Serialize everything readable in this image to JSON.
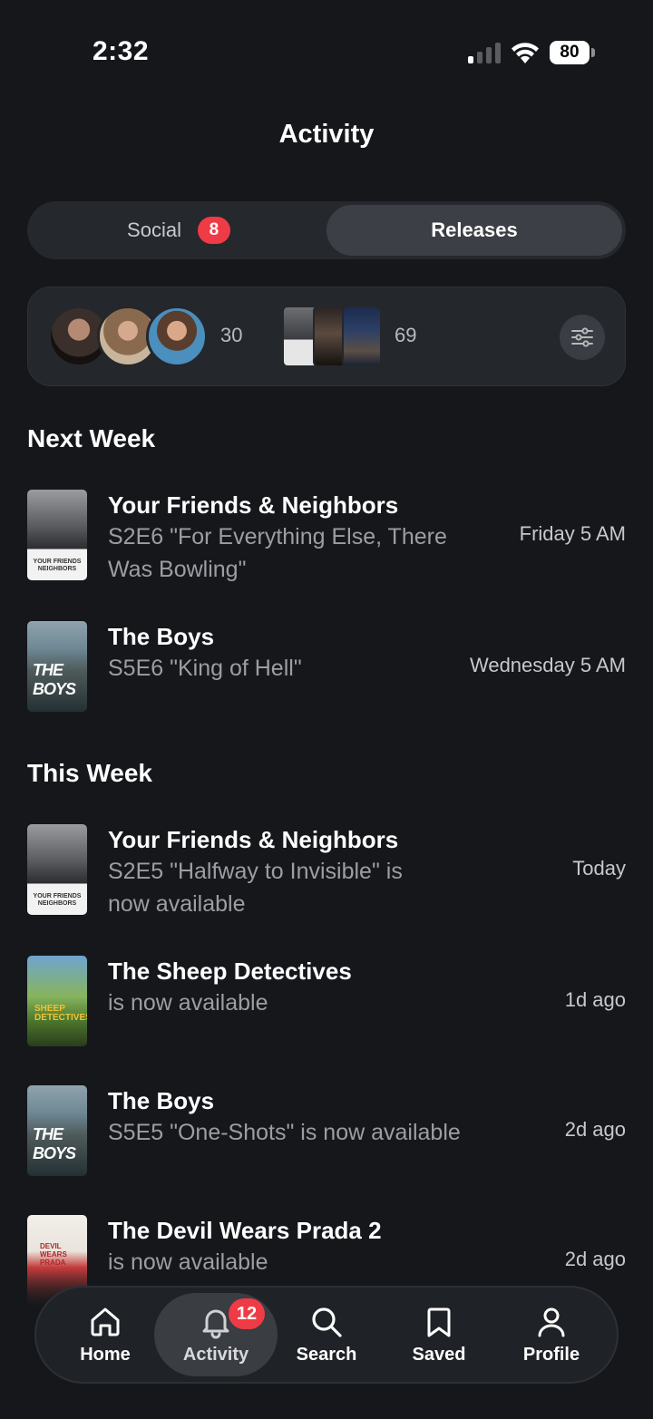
{
  "status_bar": {
    "time": "2:32",
    "battery": "80"
  },
  "header": {
    "title": "Activity"
  },
  "segmented": {
    "social_label": "Social",
    "social_badge": "8",
    "releases_label": "Releases",
    "selected": "Releases"
  },
  "follow_summary": {
    "people_count": "30",
    "titles_count": "69",
    "filter_icon": "sliders-icon"
  },
  "sections": [
    {
      "title": "Next Week",
      "items": [
        {
          "title": "Your Friends & Neighbors",
          "subtitle_line1": "S2E6 \"For Everything Else, There",
          "subtitle_line2": "Was Bowling\"",
          "time": "Friday 5 AM",
          "poster_text": "YOUR FRIENDS NEIGHBORS"
        },
        {
          "title": "The Boys",
          "subtitle_line1": "S5E6 \"King of Hell\"",
          "subtitle_line2": "",
          "time": "Wednesday 5 AM",
          "poster_text": "THE BOYS"
        }
      ]
    },
    {
      "title": "This Week",
      "items": [
        {
          "title": "Your Friends & Neighbors",
          "subtitle_line1": "S2E5 \"Halfway to Invisible\" is",
          "subtitle_line2": "now available",
          "time": "Today",
          "poster_text": "YOUR FRIENDS NEIGHBORS"
        },
        {
          "title": "The Sheep Detectives",
          "subtitle_line1": "is now available",
          "subtitle_line2": "",
          "time": "1d ago",
          "poster_text": "SHEEP DETECTIVES"
        },
        {
          "title": "The Boys",
          "subtitle_line1": "S5E5 \"One-Shots\" is now available",
          "subtitle_line2": "",
          "time": "2d ago",
          "poster_text": "THE BOYS"
        },
        {
          "title": "The Devil Wears Prada 2",
          "subtitle_line1": "is now available",
          "subtitle_line2": "",
          "time": "2d ago",
          "poster_text": "DEVIL WEARS PRADA"
        }
      ]
    }
  ],
  "nav": {
    "home": "Home",
    "activity": "Activity",
    "activity_badge": "12",
    "search": "Search",
    "saved": "Saved",
    "profile": "Profile",
    "selected": "Activity"
  },
  "colors": {
    "background": "#15171b",
    "accent_badge": "#ef3b45",
    "card": "#24272c"
  }
}
